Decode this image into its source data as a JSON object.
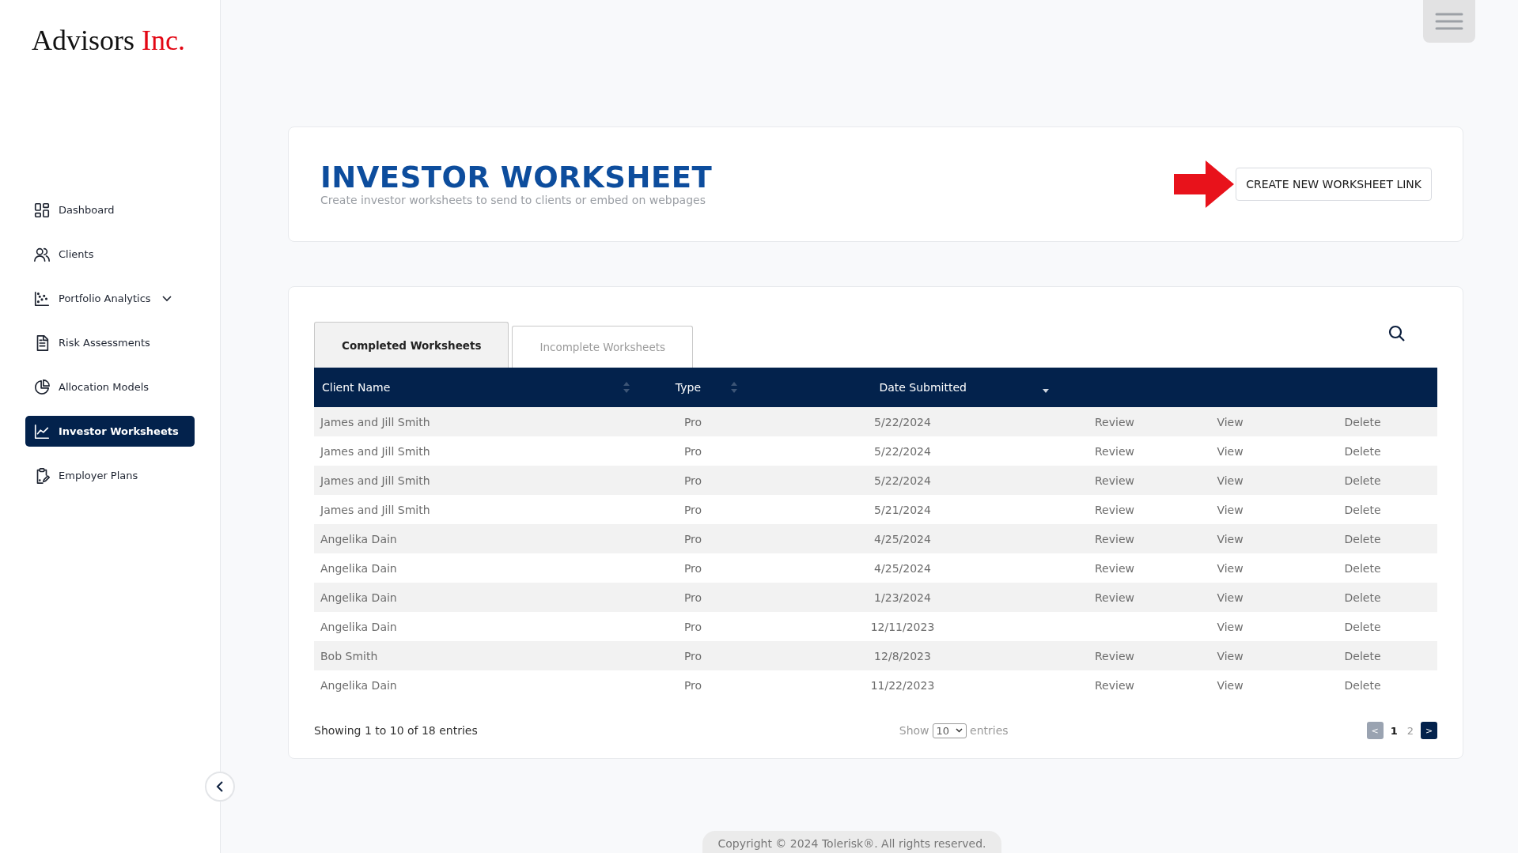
{
  "logo": {
    "name": "Advisors",
    "suffix": "Inc."
  },
  "sidebar": {
    "items": [
      {
        "label": "Dashboard",
        "selected": false,
        "has_submenu": false
      },
      {
        "label": "Clients",
        "selected": false,
        "has_submenu": false
      },
      {
        "label": "Portfolio Analytics",
        "selected": false,
        "has_submenu": true
      },
      {
        "label": "Risk Assessments",
        "selected": false,
        "has_submenu": false
      },
      {
        "label": "Allocation Models",
        "selected": false,
        "has_submenu": false
      },
      {
        "label": "Investor Worksheets",
        "selected": true,
        "has_submenu": false
      },
      {
        "label": "Employer Plans",
        "selected": false,
        "has_submenu": false
      }
    ]
  },
  "header": {
    "title": "INVESTOR WORKSHEET",
    "subtitle": "Create investor worksheets to send to clients or embed on webpages",
    "button": "CREATE NEW WORKSHEET LINK"
  },
  "tabs": [
    {
      "label": "Completed Worksheets",
      "selected": true
    },
    {
      "label": "Incomplete Worksheets",
      "selected": false
    }
  ],
  "table": {
    "columns": [
      {
        "label": "Client Name",
        "sorted": false
      },
      {
        "label": "Type",
        "sorted": false
      },
      {
        "label": "Date Submitted",
        "sorted": true
      }
    ],
    "rows": [
      {
        "client": "James and Jill Smith",
        "type": "Pro",
        "date": "5/22/2024",
        "review": "Review",
        "view": "View",
        "delete": "Delete"
      },
      {
        "client": "James and Jill Smith",
        "type": "Pro",
        "date": "5/22/2024",
        "review": "Review",
        "view": "View",
        "delete": "Delete"
      },
      {
        "client": "James and Jill Smith",
        "type": "Pro",
        "date": "5/22/2024",
        "review": "Review",
        "view": "View",
        "delete": "Delete"
      },
      {
        "client": "James and Jill Smith",
        "type": "Pro",
        "date": "5/21/2024",
        "review": "Review",
        "view": "View",
        "delete": "Delete"
      },
      {
        "client": "Angelika Dain",
        "type": "Pro",
        "date": "4/25/2024",
        "review": "Review",
        "view": "View",
        "delete": "Delete"
      },
      {
        "client": "Angelika Dain",
        "type": "Pro",
        "date": "4/25/2024",
        "review": "Review",
        "view": "View",
        "delete": "Delete"
      },
      {
        "client": "Angelika Dain",
        "type": "Pro",
        "date": "1/23/2024",
        "review": "Review",
        "view": "View",
        "delete": "Delete"
      },
      {
        "client": "Angelika Dain",
        "type": "Pro",
        "date": "12/11/2023",
        "view": "View",
        "delete": "Delete"
      },
      {
        "client": "Bob Smith",
        "type": "Pro",
        "date": "12/8/2023",
        "review": "Review",
        "view": "View",
        "delete": "Delete"
      },
      {
        "client": "Angelika Dain",
        "type": "Pro",
        "date": "11/22/2023",
        "review": "Review",
        "view": "View",
        "delete": "Delete"
      }
    ]
  },
  "footer_bar": {
    "info": "Showing 1 to 10 of 18 entries",
    "show_label": "Show",
    "page_size": "10",
    "entries_label": "entries",
    "prev": {
      "label": "<",
      "disabled": true
    },
    "pages": [
      {
        "label": "1",
        "selected": true
      },
      {
        "label": "2",
        "selected": false
      }
    ],
    "next": {
      "label": ">",
      "disabled": false
    }
  },
  "copyright": "Copyright © 2024 Tolerisk®. All rights reserved."
}
